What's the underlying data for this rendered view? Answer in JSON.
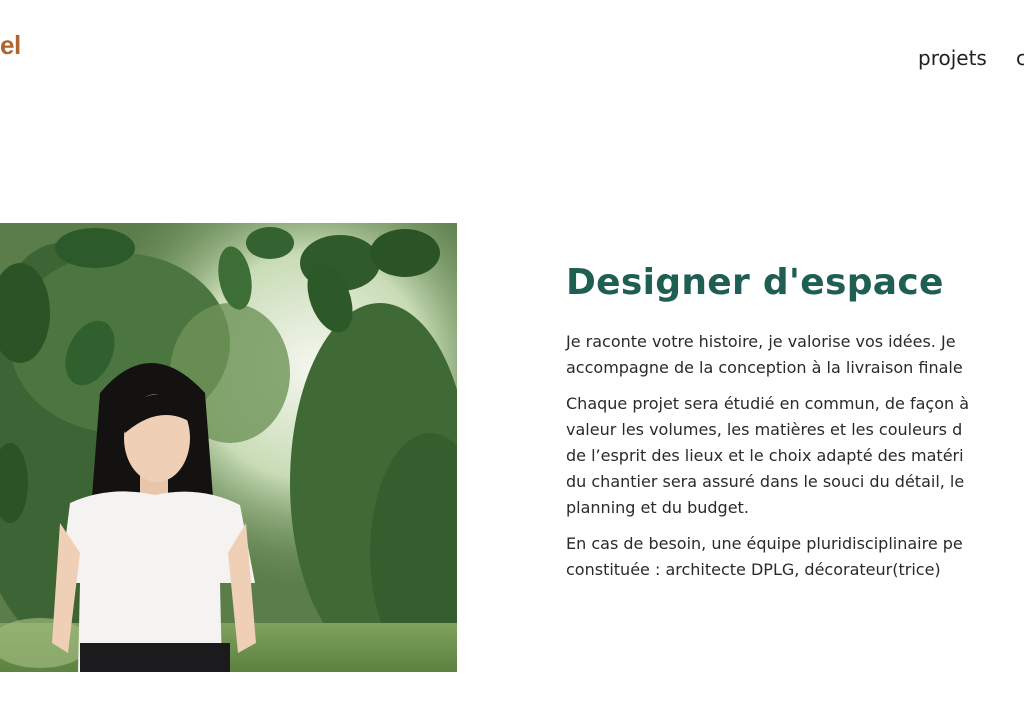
{
  "logo": {
    "text": "el"
  },
  "nav": {
    "items": [
      "projets",
      "c"
    ]
  },
  "about": {
    "heading": "Designer d'espace",
    "paragraphs": [
      [
        "Je raconte votre histoire, je valorise vos idées. Je",
        "accompagne de la conception à la livraison finale"
      ],
      [
        "Chaque projet sera étudié en commun, de façon à",
        "valeur les volumes, les matières et les couleurs d",
        "de l’esprit des lieux et le choix adapté des matéri",
        "du chantier sera assuré dans le souci du détail, le",
        "planning et du budget."
      ],
      [
        "En cas de besoin, une équipe pluridisciplinaire pe",
        "constituée : architecte DPLG, décorateur(trice)"
      ]
    ]
  },
  "colors": {
    "logo": "#b0652f",
    "heading": "#1f5e52",
    "text": "#2a2a2a"
  }
}
